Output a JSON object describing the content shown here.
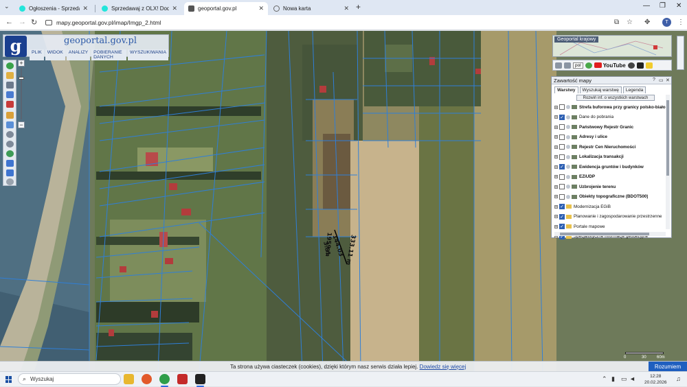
{
  "browser": {
    "tabs": [
      {
        "label": "Ogłoszenia - Sprzedam, kupię",
        "active": false,
        "favicon_color": "#23e5db"
      },
      {
        "label": "Sprzedawaj z OLX! Dodaj ofertę",
        "active": false,
        "favicon_color": "#23e5db"
      },
      {
        "label": "geoportal.gov.pl",
        "active": true,
        "favicon_color": "#555555"
      },
      {
        "label": "Nowa karta",
        "active": false,
        "favicon_color": "#666666"
      }
    ],
    "url": "mapy.geoportal.gov.pl/imap/Imgp_2.html",
    "profile_initial": "T"
  },
  "geoportal": {
    "logo_letter": "g",
    "logo_text": "geoportal.gov.pl",
    "menu": [
      "PLIK",
      "WIDOK",
      "ANALIZY",
      "POBIERANIE DANYCH",
      "WYSZUKIWANIA"
    ],
    "overview_title": "Geoportal krajowy",
    "language": "pol",
    "youtube_label": "YouTube",
    "content_panel": {
      "title": "Zawartość mapy",
      "tabs": [
        "Warstwy",
        "Wyszukaj warstwę",
        "Legenda"
      ],
      "button": "Rozwiń inf. o wszystkich warstwach",
      "layers": [
        {
          "label": "Strefa buforowa przy granicy polsko-białoruskiej",
          "checked": false,
          "bold": true,
          "folder": false
        },
        {
          "label": "Dane do pobrania",
          "checked": true,
          "bold": false,
          "folder": false
        },
        {
          "label": "Państwowy Rejestr Granic",
          "checked": false,
          "bold": true,
          "folder": false
        },
        {
          "label": "Adresy i ulice",
          "checked": false,
          "bold": true,
          "folder": false
        },
        {
          "label": "Rejestr Cen Nieruchomości",
          "checked": false,
          "bold": true,
          "folder": false
        },
        {
          "label": "Lokalizacja transakcji",
          "checked": false,
          "bold": true,
          "folder": false
        },
        {
          "label": "Ewidencja gruntów i budynków",
          "checked": true,
          "bold": true,
          "folder": false
        },
        {
          "label": "EZiUDP",
          "checked": false,
          "bold": true,
          "folder": false
        },
        {
          "label": "Uzbrojenie terenu",
          "checked": false,
          "bold": true,
          "folder": false
        },
        {
          "label": "Obiekty topograficzne (BDOT500)",
          "checked": false,
          "bold": true,
          "folder": false
        },
        {
          "label": "Modernizacja EGiB",
          "checked": true,
          "bold": false,
          "folder": true
        },
        {
          "label": "Planowanie i zagospodarowanie przestrzenne",
          "checked": true,
          "bold": false,
          "folder": true
        },
        {
          "label": "Portale mapowe",
          "checked": true,
          "bold": false,
          "folder": true
        },
        {
          "label": "Specjalistyczne informacje geodezyjne",
          "checked": true,
          "bold": false,
          "folder": true
        }
      ]
    },
    "measure_labels": [
      "144.03",
      "3.81",
      "333.11 m",
      "1959 m"
    ],
    "scale": {
      "n0": "0",
      "n1": "30",
      "n2": "60m"
    },
    "cookie_text": "Ta strona używa ciasteczek (cookies), dzięki którym nasz serwis działa lepiej.",
    "cookie_link": "Dowiedz się więcej",
    "cookie_button": "Rozumiem"
  },
  "taskbar": {
    "search_placeholder": "Wyszukaj",
    "time": "12:28",
    "date": "20.02.2026"
  }
}
